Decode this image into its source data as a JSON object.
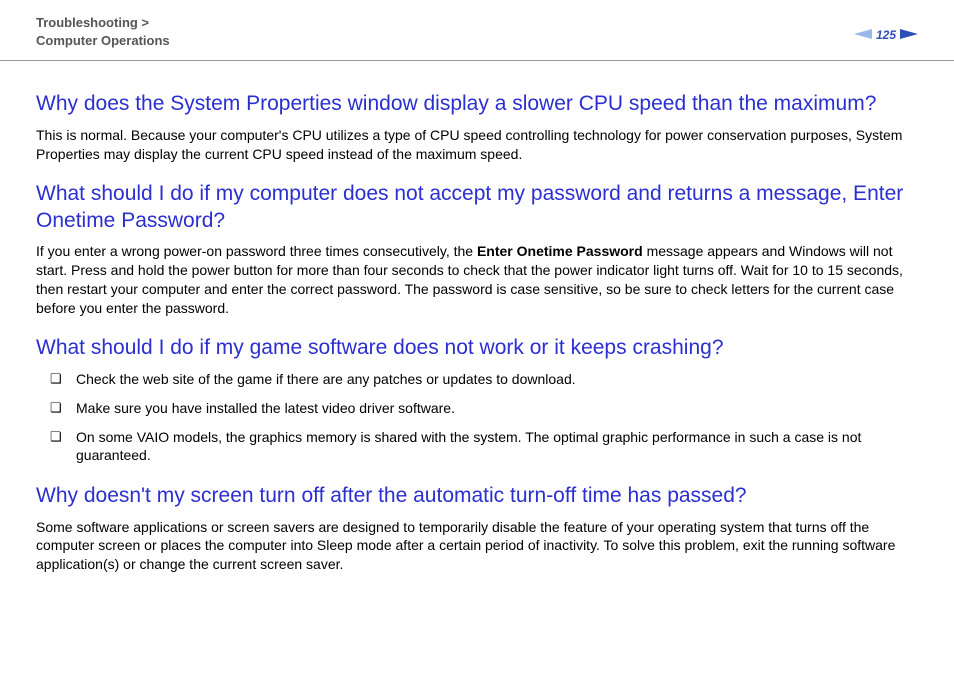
{
  "header": {
    "breadcrumb_line1": "Troubleshooting >",
    "breadcrumb_line2": "Computer Operations",
    "page_number": "125"
  },
  "sections": {
    "q1": {
      "heading": "Why does the System Properties window display a slower CPU speed than the maximum?",
      "body": "This is normal. Because your computer's CPU utilizes a type of CPU speed controlling technology for power conservation purposes, System Properties may display the current CPU speed instead of the maximum speed."
    },
    "q2": {
      "heading": "What should I do if my computer does not accept my password and returns a message, Enter Onetime Password?",
      "body_a": "If you enter a wrong power-on password three times consecutively, the ",
      "body_bold": "Enter Onetime Password",
      "body_b": " message appears and Windows will not start. Press and hold the power button for more than four seconds to check that the power indicator light turns off. Wait for 10 to 15 seconds, then restart your computer and enter the correct password. The password is case sensitive, so be sure to check letters for the current case before you enter the password."
    },
    "q3": {
      "heading": "What should I do if my game software does not work or it keeps crashing?",
      "bullets": {
        "b1": "Check the web site of the game if there are any patches or updates to download.",
        "b2": "Make sure you have installed the latest video driver software.",
        "b3": "On some VAIO models, the graphics memory is shared with the system. The optimal graphic performance in such a case is not guaranteed."
      }
    },
    "q4": {
      "heading": "Why doesn't my screen turn off after the automatic turn-off time has passed?",
      "body": "Some software applications or screen savers are designed to temporarily disable the feature of your operating system that turns off the computer screen or places the computer into Sleep mode after a certain period of inactivity. To solve this problem, exit the running software application(s) or change the current screen saver."
    }
  }
}
